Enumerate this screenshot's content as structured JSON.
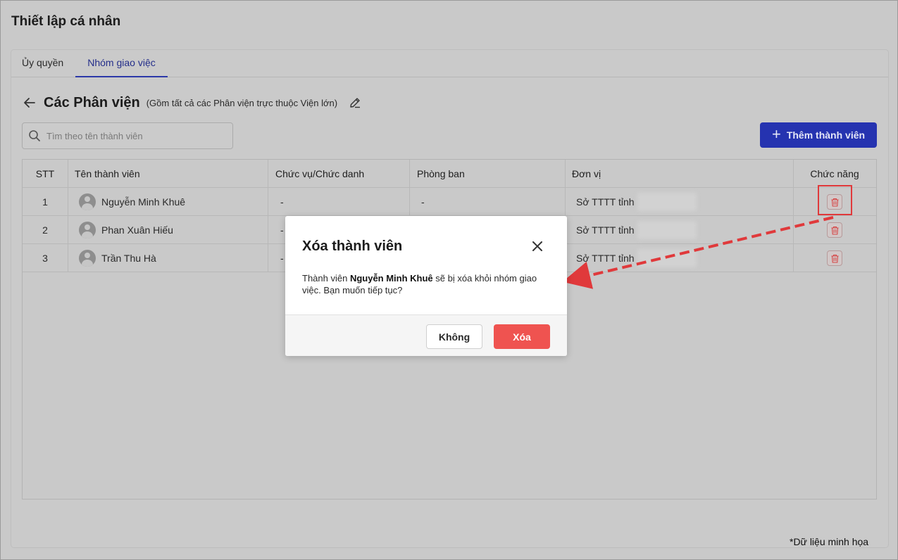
{
  "page": {
    "title": "Thiết lập cá nhân"
  },
  "tabs": [
    {
      "label": "Ủy quyền",
      "active": false
    },
    {
      "label": "Nhóm giao việc",
      "active": true
    }
  ],
  "group": {
    "title": "Các Phân viện",
    "description": "(Gồm tất cả các Phân viện trực thuộc Viện lớn)"
  },
  "search": {
    "placeholder": "Tìm theo tên thành viên",
    "value": ""
  },
  "add_button": {
    "label": "Thêm thành viên"
  },
  "table": {
    "headers": [
      "STT",
      "Tên thành viên",
      "Chức vụ/Chức danh",
      "Phòng ban",
      "Đơn vị",
      "Chức năng"
    ],
    "rows": [
      {
        "stt": "1",
        "name": "Nguyễn Minh Khuê",
        "position": "-",
        "department": "-",
        "unit": "Sở TTTT tỉnh"
      },
      {
        "stt": "2",
        "name": "Phan Xuân Hiếu",
        "position": "-",
        "department": "",
        "unit": "Sở TTTT tỉnh"
      },
      {
        "stt": "3",
        "name": "Trần Thu Hà",
        "position": "-",
        "department": "",
        "unit": "Sở TTTT tỉnh"
      }
    ]
  },
  "modal": {
    "title": "Xóa thành viên",
    "body_prefix": "Thành viên ",
    "body_name": "Nguyễn Minh Khuê",
    "body_suffix": " sẽ bị xóa khỏi nhóm giao việc. Bạn muốn tiếp tục?",
    "cancel_label": "Không",
    "confirm_label": "Xóa"
  },
  "footnote": "*Dữ liệu minh họa",
  "colors": {
    "primary": "#2533b0",
    "danger": "#ef5350",
    "annotation": "#e0393b"
  },
  "icons": [
    "back-arrow-icon",
    "edit-icon",
    "search-icon",
    "plus-icon",
    "trash-icon",
    "close-icon",
    "user-avatar-icon"
  ]
}
